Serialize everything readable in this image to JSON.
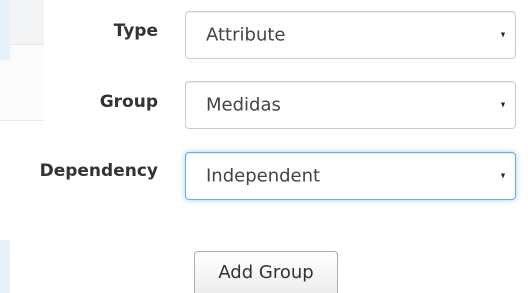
{
  "form": {
    "fields": [
      {
        "label": "Type",
        "value": "Attribute"
      },
      {
        "label": "Group",
        "value": "Medidas"
      },
      {
        "label": "Dependency",
        "value": "Independent"
      }
    ],
    "add_group_label": "Add Group"
  },
  "icons": {
    "select_caret": "caret-down-icon"
  },
  "colors": {
    "focus_border": "#66afe9",
    "label_text": "#333333"
  }
}
